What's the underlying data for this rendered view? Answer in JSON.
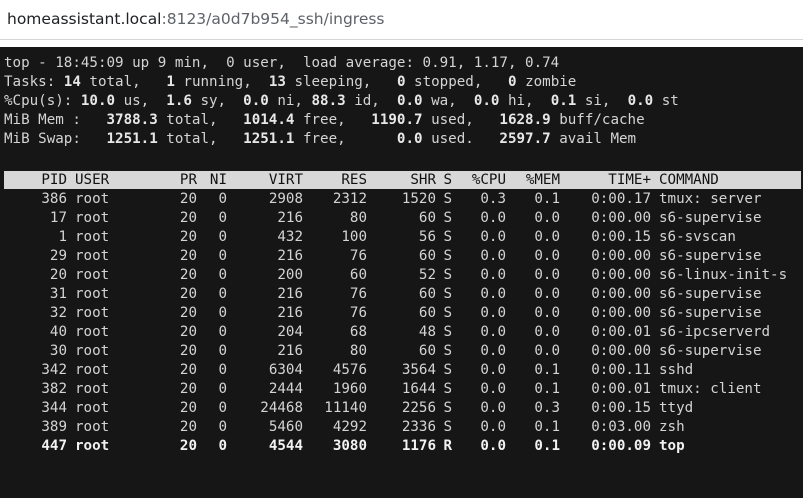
{
  "address_bar": {
    "host": "homeassistant.local",
    "path": ":8123/a0d7b954_ssh/ingress"
  },
  "summary": {
    "line1": "top - 18:45:09 up 9 min,  0 user,  load average: 0.91, 1.17, 0.74",
    "tasks": {
      "prefix": "Tasks: ",
      "total": "14",
      "total_label": " total,   ",
      "running": "1",
      "running_label": " running,  ",
      "sleeping": "13",
      "sleeping_label": " sleeping,   ",
      "stopped": "0",
      "stopped_label": " stopped,   ",
      "zombie": "0",
      "zombie_label": " zombie"
    },
    "cpu": {
      "prefix": "%Cpu(s): ",
      "us": "10.0",
      "us_label": " us,  ",
      "sy": "1.6",
      "sy_label": " sy,  ",
      "ni": "0.0",
      "ni_label": " ni, ",
      "id": "88.3",
      "id_label": " id,  ",
      "wa": "0.0",
      "wa_label": " wa,  ",
      "hi": "0.0",
      "hi_label": " hi,  ",
      "si": "0.1",
      "si_label": " si,  ",
      "st": "0.0",
      "st_label": " st"
    },
    "mem": {
      "prefix": "MiB Mem :   ",
      "total": "3788.3",
      "total_label": " total,   ",
      "free": "1014.4",
      "free_label": " free,   ",
      "used": "1190.7",
      "used_label": " used,   ",
      "buff": "1628.9",
      "buff_label": " buff/cache"
    },
    "swap": {
      "prefix": "MiB Swap:   ",
      "total": "1251.1",
      "total_label": " total,   ",
      "free": "1251.1",
      "free_label": " free,      ",
      "used": "0.0",
      "used_label": " used.   ",
      "avail": "2597.7",
      "avail_label": " avail Mem"
    }
  },
  "table": {
    "columns": [
      "PID",
      "USER",
      "PR",
      "NI",
      "VIRT",
      "RES",
      "SHR",
      "S",
      "%CPU",
      "%MEM",
      "TIME+",
      "COMMAND"
    ],
    "rows": [
      [
        "386",
        "root",
        "20",
        "0",
        "2908",
        "2312",
        "1520",
        "S",
        "0.3",
        "0.1",
        "0:00.17",
        "tmux: server"
      ],
      [
        "17",
        "root",
        "20",
        "0",
        "216",
        "80",
        "60",
        "S",
        "0.0",
        "0.0",
        "0:00.00",
        "s6-supervise"
      ],
      [
        "1",
        "root",
        "20",
        "0",
        "432",
        "100",
        "56",
        "S",
        "0.0",
        "0.0",
        "0:00.15",
        "s6-svscan"
      ],
      [
        "29",
        "root",
        "20",
        "0",
        "216",
        "76",
        "60",
        "S",
        "0.0",
        "0.0",
        "0:00.00",
        "s6-supervise"
      ],
      [
        "20",
        "root",
        "20",
        "0",
        "200",
        "60",
        "52",
        "S",
        "0.0",
        "0.0",
        "0:00.00",
        "s6-linux-init-s"
      ],
      [
        "31",
        "root",
        "20",
        "0",
        "216",
        "76",
        "60",
        "S",
        "0.0",
        "0.0",
        "0:00.00",
        "s6-supervise"
      ],
      [
        "32",
        "root",
        "20",
        "0",
        "216",
        "76",
        "60",
        "S",
        "0.0",
        "0.0",
        "0:00.00",
        "s6-supervise"
      ],
      [
        "40",
        "root",
        "20",
        "0",
        "204",
        "68",
        "48",
        "S",
        "0.0",
        "0.0",
        "0:00.01",
        "s6-ipcserverd"
      ],
      [
        "30",
        "root",
        "20",
        "0",
        "216",
        "80",
        "60",
        "S",
        "0.0",
        "0.0",
        "0:00.00",
        "s6-supervise"
      ],
      [
        "342",
        "root",
        "20",
        "0",
        "6304",
        "4576",
        "3564",
        "S",
        "0.0",
        "0.1",
        "0:00.11",
        "sshd"
      ],
      [
        "382",
        "root",
        "20",
        "0",
        "2444",
        "1960",
        "1644",
        "S",
        "0.0",
        "0.1",
        "0:00.01",
        "tmux: client"
      ],
      [
        "344",
        "root",
        "20",
        "0",
        "24468",
        "11140",
        "2256",
        "S",
        "0.0",
        "0.3",
        "0:00.15",
        "ttyd"
      ],
      [
        "389",
        "root",
        "20",
        "0",
        "5460",
        "4292",
        "2336",
        "S",
        "0.0",
        "0.1",
        "0:03.00",
        "zsh"
      ],
      [
        "447",
        "root",
        "20",
        "0",
        "4544",
        "3080",
        "1176",
        "R",
        "0.0",
        "0.1",
        "0:00.09",
        "top"
      ]
    ],
    "bold_row_index": 13
  }
}
